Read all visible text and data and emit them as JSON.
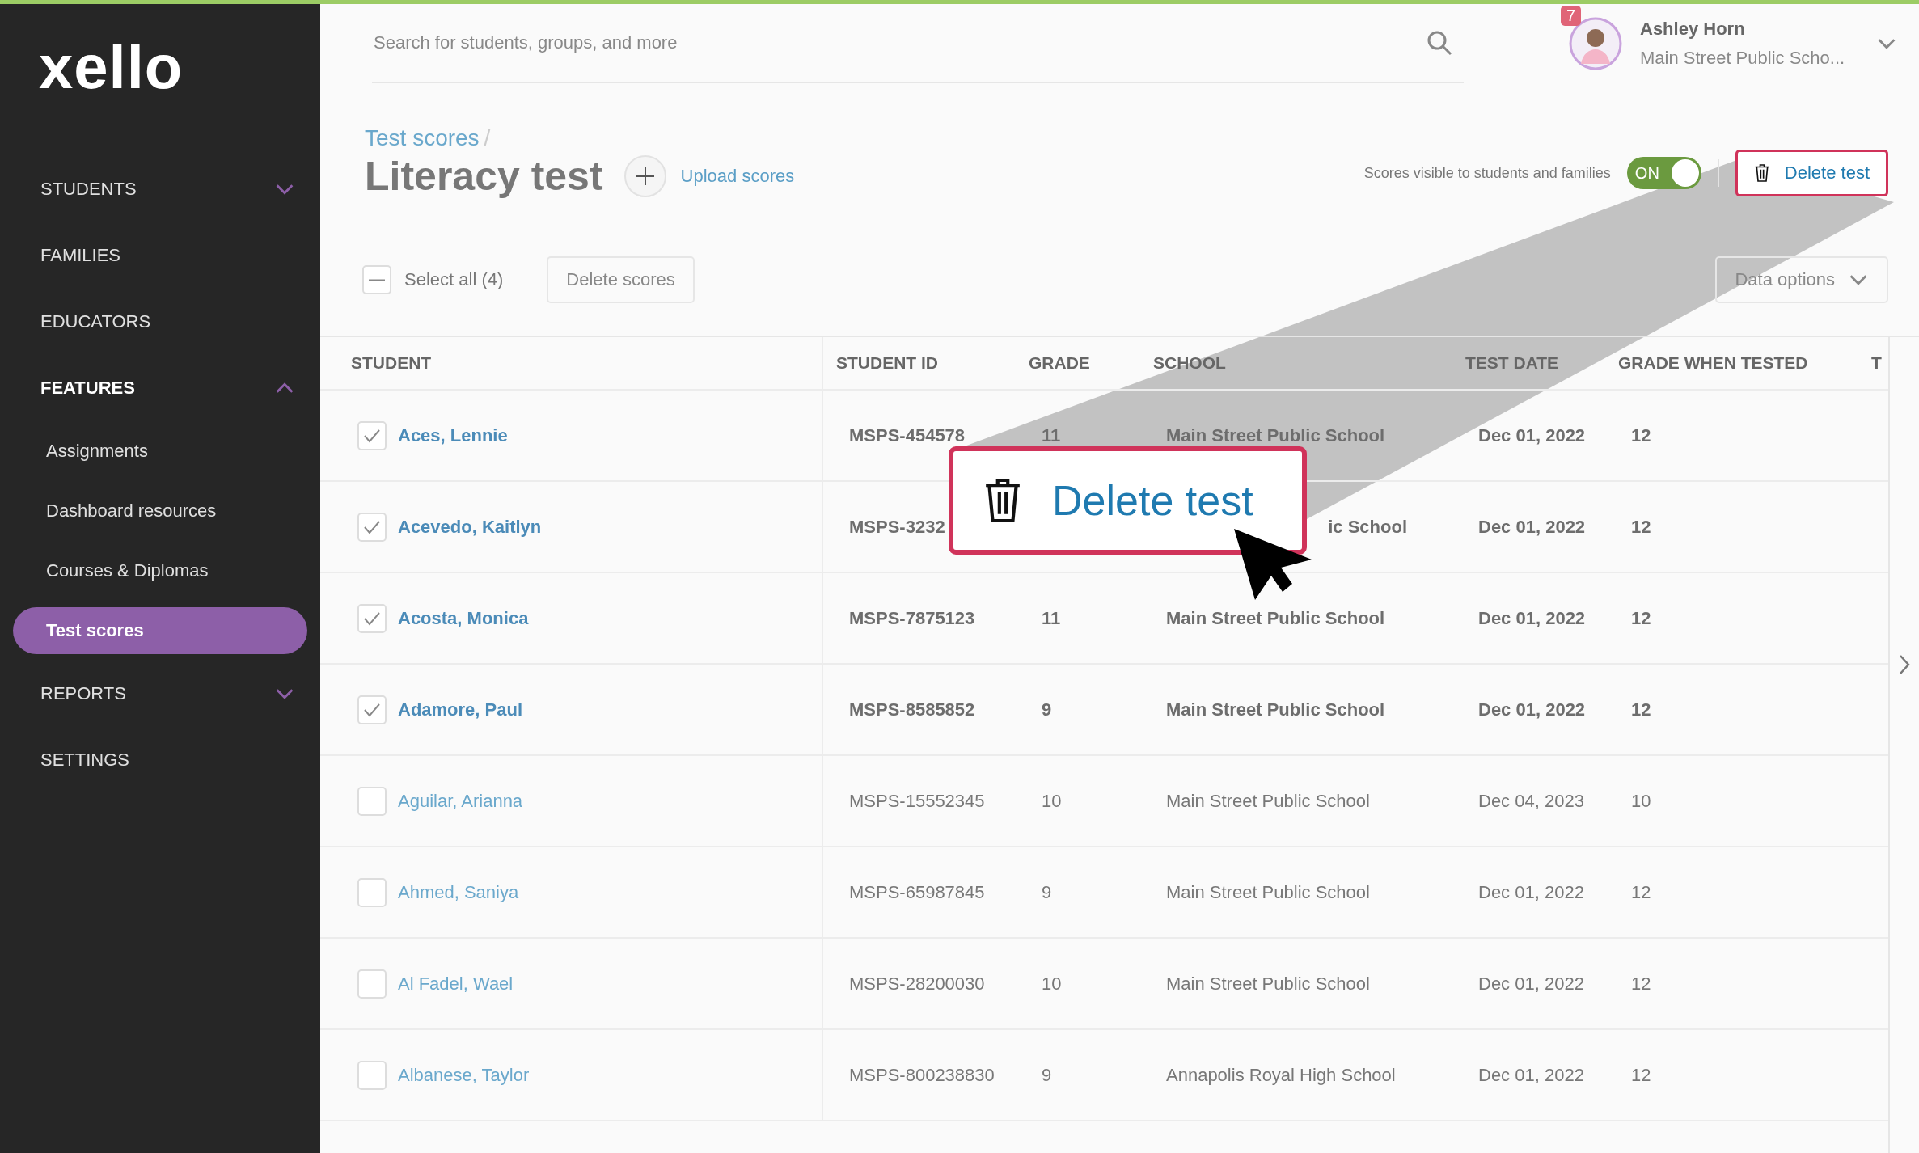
{
  "sidebar": {
    "logo": "xello",
    "items": [
      {
        "label": "STUDENTS",
        "kind": "section",
        "expanded": false
      },
      {
        "label": "FAMILIES",
        "kind": "link"
      },
      {
        "label": "EDUCATORS",
        "kind": "link"
      },
      {
        "label": "FEATURES",
        "kind": "section",
        "expanded": true,
        "children": [
          {
            "label": "Assignments",
            "selected": false
          },
          {
            "label": "Dashboard resources",
            "selected": false
          },
          {
            "label": "Courses & Diplomas",
            "selected": false
          },
          {
            "label": "Test scores",
            "selected": true
          }
        ]
      },
      {
        "label": "REPORTS",
        "kind": "section",
        "expanded": false
      },
      {
        "label": "SETTINGS",
        "kind": "link"
      }
    ]
  },
  "header": {
    "search": {
      "placeholder": "Search for students, groups, and more"
    },
    "user": {
      "name": "Ashley Horn",
      "school": "Main Street Public Scho...",
      "badge": "7"
    }
  },
  "page": {
    "breadcrumb": "Test scores",
    "breadcrumb_separator": "/",
    "title": "Literacy test",
    "upload": "Upload scores",
    "visibility_label": "Scores visible to students and families",
    "toggle": {
      "label": "ON",
      "on": true
    },
    "delete_button": "Delete test"
  },
  "toolbar": {
    "select_all": {
      "label": "Select all (4)",
      "indeterminate": true
    },
    "delete_scores": "Delete scores",
    "data_options": "Data options"
  },
  "table": {
    "columns": [
      "STUDENT",
      "STUDENT ID",
      "GRADE",
      "SCHOOL",
      "TEST DATE",
      "GRADE WHEN TESTED",
      "T"
    ],
    "rows": [
      {
        "kind": "full",
        "checked": true,
        "student": "Aces, Lennie",
        "student_id": "MSPS-454578",
        "grade": "11",
        "school": "Main Street Public School",
        "test_date": "Dec 01, 2022",
        "grade_when_tested": "12"
      },
      {
        "kind": "partly_hidden",
        "checked": true,
        "student": "Acevedo, Kaitlyn",
        "student_id": "MSPS-3232",
        "school": "ic School",
        "test_date": "Dec 01, 2022",
        "grade_when_tested": "12"
      },
      {
        "kind": "full",
        "checked": true,
        "student": "Acosta, Monica",
        "student_id": "MSPS-7875123",
        "grade": "11",
        "school": "Main Street Public School",
        "test_date": "Dec 01, 2022",
        "grade_when_tested": "12"
      },
      {
        "kind": "full",
        "checked": true,
        "student": "Adamore, Paul",
        "student_id": "MSPS-8585852",
        "grade": "9",
        "school": "Main Street Public School",
        "test_date": "Dec 01, 2022",
        "grade_when_tested": "12"
      },
      {
        "kind": "full",
        "checked": false,
        "student": "Aguilar, Arianna",
        "student_id": "MSPS-15552345",
        "grade": "10",
        "school": "Main Street Public School",
        "test_date": "Dec 04, 2023",
        "grade_when_tested": "10"
      },
      {
        "kind": "full",
        "checked": false,
        "student": "Ahmed, Saniya",
        "student_id": "MSPS-65987845",
        "grade": "9",
        "school": "Main Street Public School",
        "test_date": "Dec 01, 2022",
        "grade_when_tested": "12"
      },
      {
        "kind": "full",
        "checked": false,
        "student": "Al Fadel, Wael",
        "student_id": "MSPS-28200030",
        "grade": "10",
        "school": "Main Street Public School",
        "test_date": "Dec 01, 2022",
        "grade_when_tested": "12"
      },
      {
        "kind": "full",
        "checked": false,
        "student": "Albanese, Taylor",
        "student_id": "MSPS-800238830",
        "grade": "9",
        "school": "Annapolis Royal High School",
        "test_date": "Dec 01, 2022",
        "grade_when_tested": "12"
      }
    ]
  },
  "callout": {
    "label": "Delete test"
  }
}
